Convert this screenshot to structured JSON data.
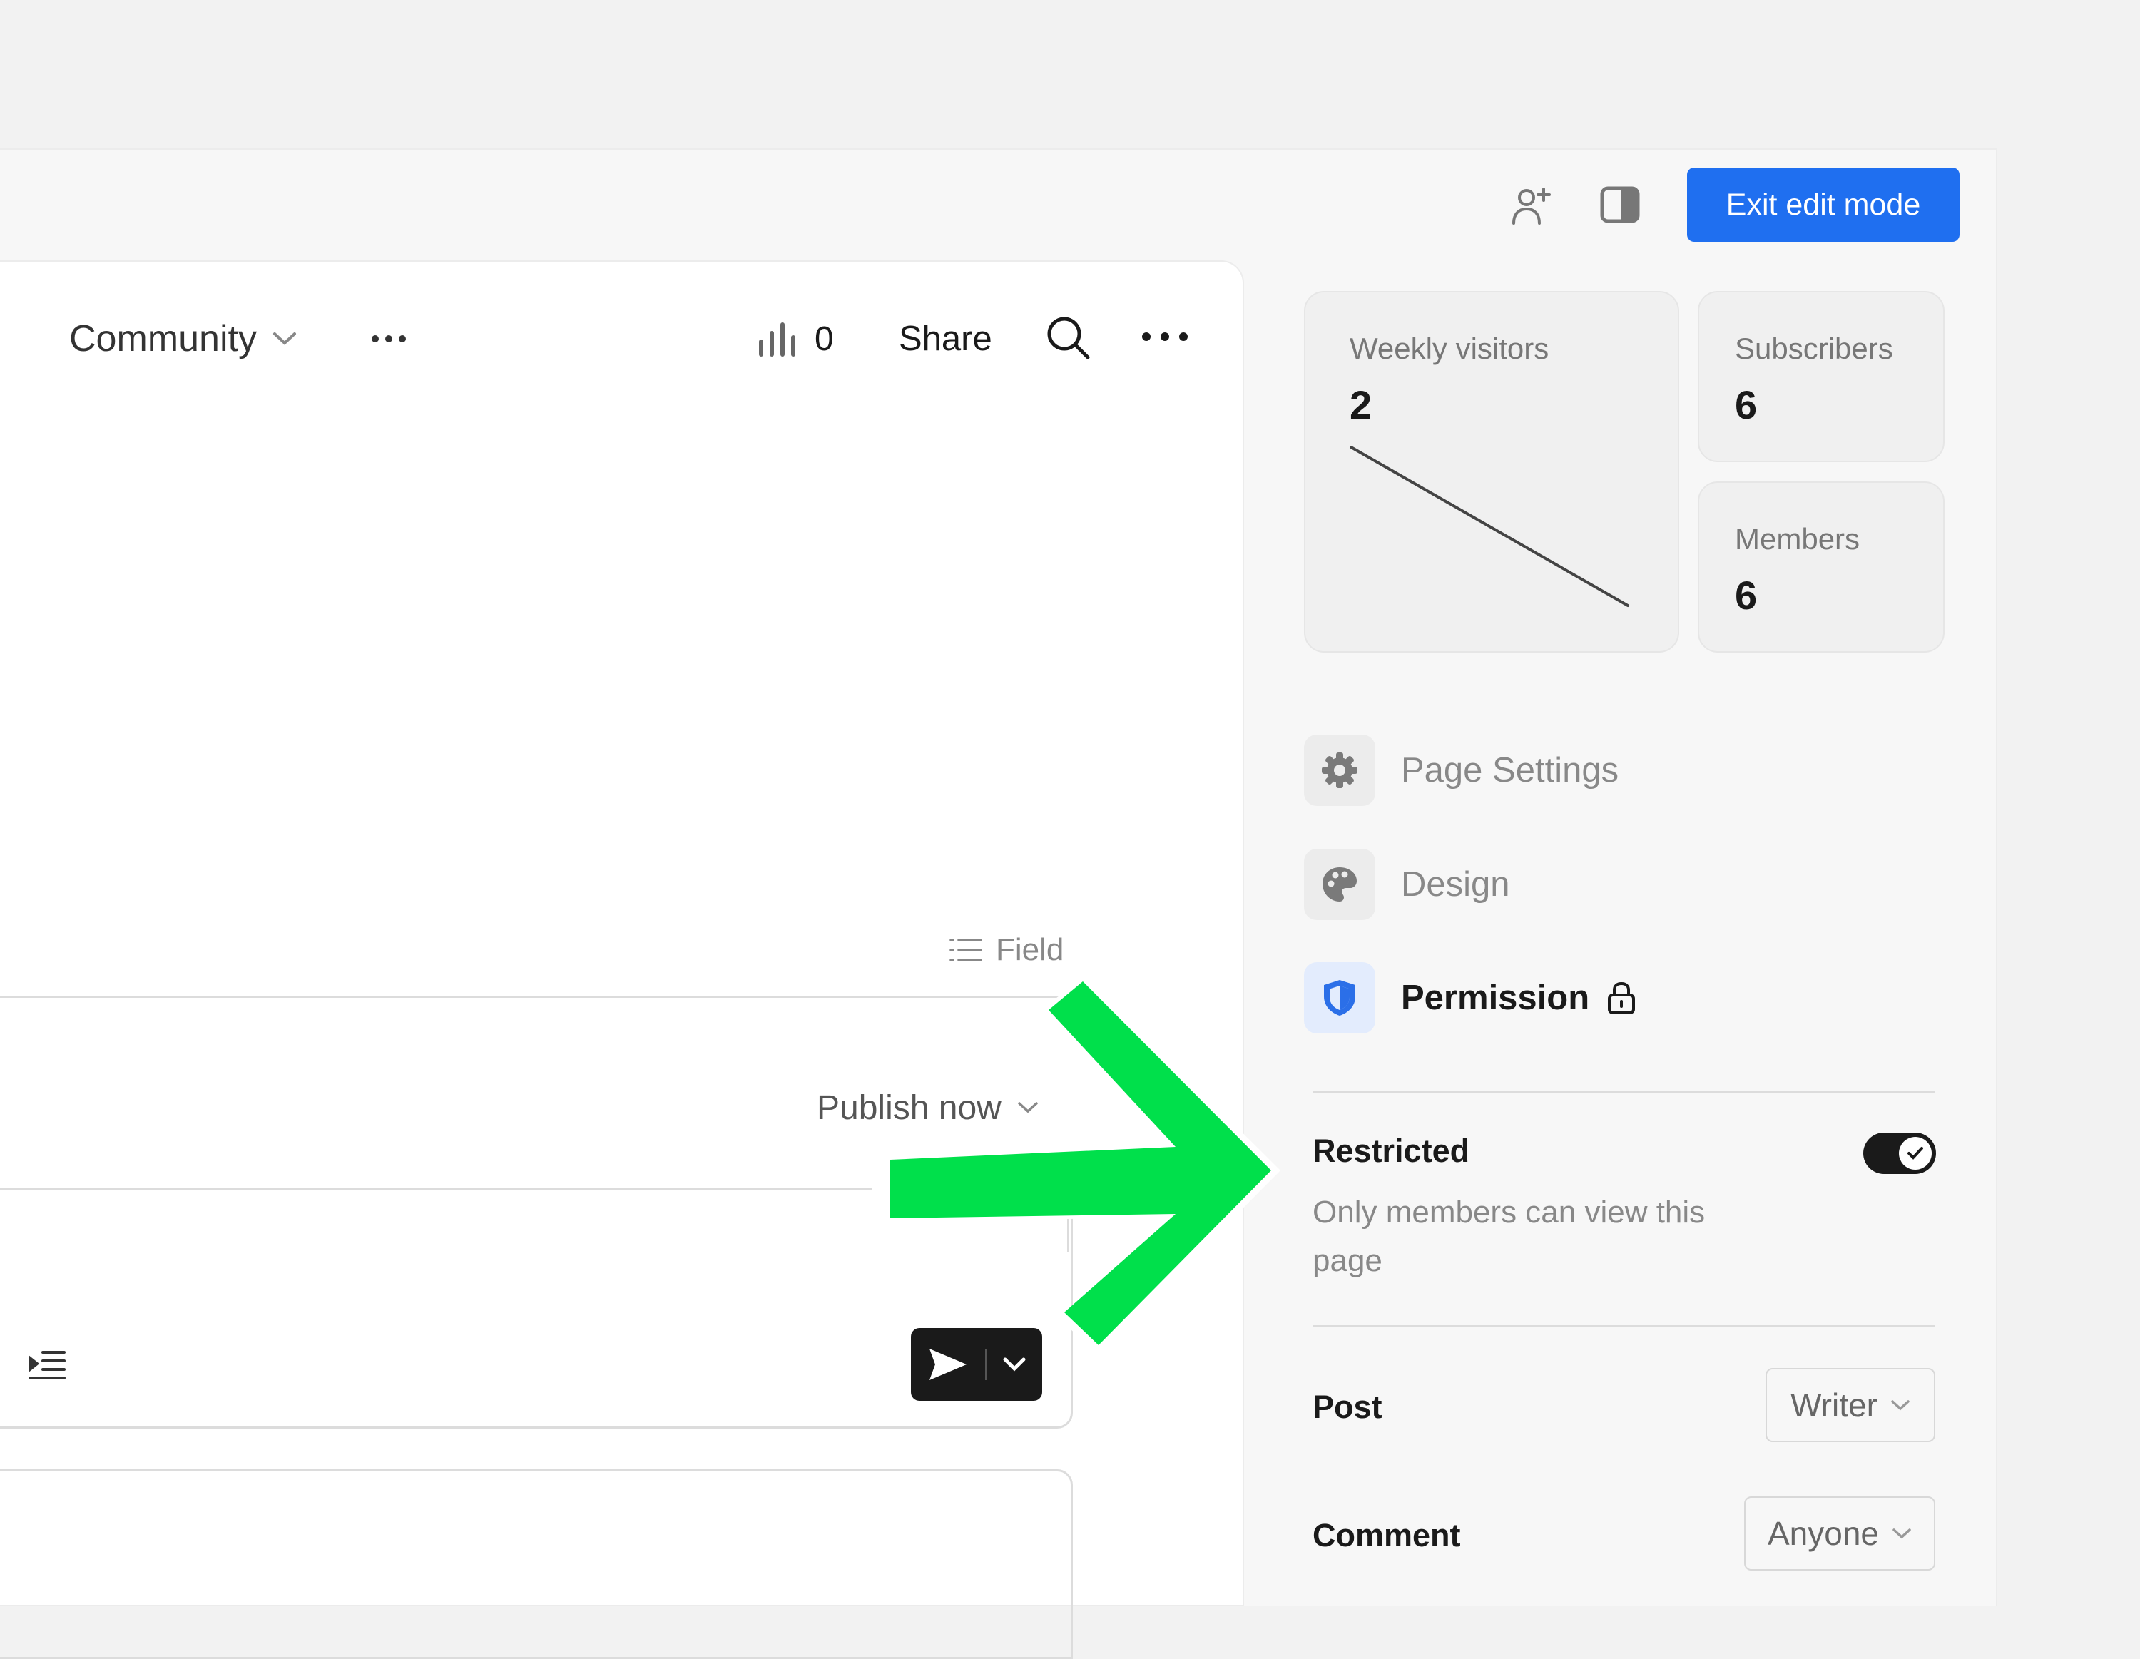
{
  "header": {
    "exit_edit_mode_label": "Exit edit mode"
  },
  "toolbar": {
    "space_name": "Community",
    "views_count": "0",
    "share_label": "Share"
  },
  "editor": {
    "field_label": "Field",
    "publish_label": "Publish now"
  },
  "stats": {
    "weekly_visitors": {
      "label": "Weekly visitors",
      "value": "2"
    },
    "subscribers": {
      "label": "Subscribers",
      "value": "6"
    },
    "members": {
      "label": "Members",
      "value": "6"
    }
  },
  "sidebar_menu": [
    {
      "label": "Page Settings",
      "icon": "gear-icon"
    },
    {
      "label": "Design",
      "icon": "palette-icon"
    },
    {
      "label": "Permission",
      "icon": "shield-icon"
    }
  ],
  "permission": {
    "restricted_title": "Restricted",
    "restricted_desc_line1": "Only members can view this",
    "restricted_desc_line2": "page",
    "restricted_enabled": true,
    "post_label": "Post",
    "post_value": "Writer",
    "comment_label": "Comment",
    "comment_value": "Anyone"
  },
  "colors": {
    "accent": "#1f6ff0",
    "annotation_arrow": "#00e04b"
  }
}
